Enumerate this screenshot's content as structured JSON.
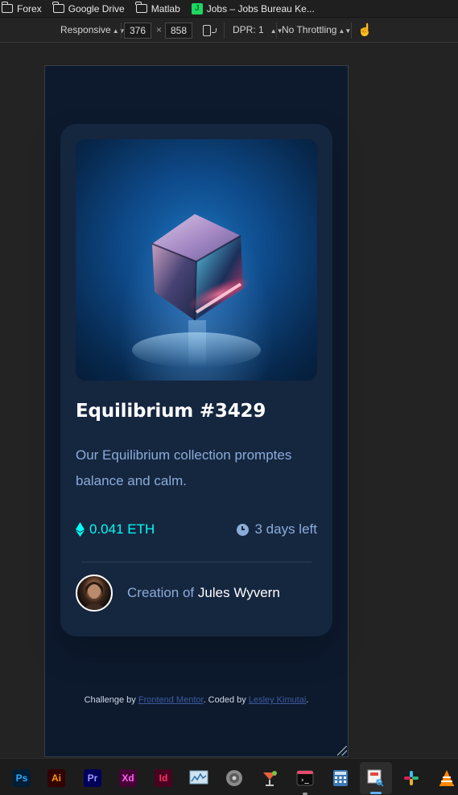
{
  "bookmarks": [
    {
      "label": "Forex",
      "icon": "folder-icon"
    },
    {
      "label": "Google Drive",
      "icon": "folder-icon"
    },
    {
      "label": "Matlab",
      "icon": "folder-icon"
    },
    {
      "label": "Jobs – Jobs Bureau Ke...",
      "icon": "jobs-favicon-icon"
    }
  ],
  "device_toolbar": {
    "device": "Responsive",
    "width": "376",
    "times": "×",
    "height": "858",
    "dpr": "DPR: 1",
    "throttling": "No Throttling"
  },
  "card": {
    "title": "Equilibrium #3429",
    "description": "Our Equilibrium collection promptes balance and calm.",
    "price": "0.041 ETH",
    "time_left": "3 days left",
    "creation_prefix": "Creation of",
    "creator_name": "Jules Wyvern"
  },
  "attribution": {
    "prefix": "Challenge by ",
    "link1": "Frontend Mentor",
    "middle": ". Coded by ",
    "link2": "Lesley Kimutai",
    "suffix": "."
  },
  "taskbar": {
    "apps": [
      {
        "label": "Ps",
        "name": "photoshop-icon",
        "color": "#31a8ff",
        "bg": "#001e36"
      },
      {
        "label": "Ai",
        "name": "illustrator-icon",
        "color": "#ff9a00",
        "bg": "#330000"
      },
      {
        "label": "Pr",
        "name": "premiere-icon",
        "color": "#9999ff",
        "bg": "#00005b"
      },
      {
        "label": "Xd",
        "name": "xd-icon",
        "color": "#ff61f6",
        "bg": "#470137"
      },
      {
        "label": "Id",
        "name": "indesign-icon",
        "color": "#ff3366",
        "bg": "#49021f"
      }
    ]
  },
  "colors": {
    "cyan": "#00fff8",
    "soft_blue": "#8bacd9",
    "card_bg": "#15263f",
    "page_bg": "#0d1a2e"
  }
}
